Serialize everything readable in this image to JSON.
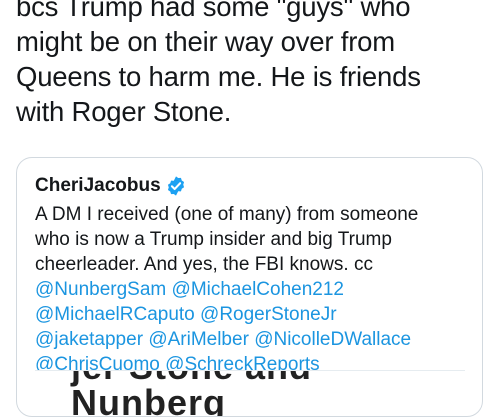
{
  "tweet": {
    "text": "bcs Trump had some \"guys\" who\nmight be on their way over from\nQueens to harm me.  He is friends\nwith Roger Stone."
  },
  "quote": {
    "author": "CheriJacobus",
    "verified_icon": "verified-badge-icon",
    "text_line1": "A DM I received (one of many) from someone",
    "text_line2": "who is now a Trump insider and big Trump",
    "text_line3": "cheerleader.  And yes, the FBI knows.  cc",
    "mentions_line4": [
      "@NunbergSam",
      "@MichaelCohen212"
    ],
    "mentions_line5": [
      "@MichaelRCaputo",
      "@RogerStoneJr"
    ],
    "mentions_line6": [
      "@jaketapper",
      "@AriMelber",
      "@NicolleDWallace"
    ],
    "mentions_line7": [
      "@ChrisCuomo",
      "@SchreckReports"
    ],
    "media_caption": "jer Stone and Nunberg"
  },
  "colors": {
    "text": "#14171a",
    "link": "#1b95e0",
    "verified": "#1da1f2",
    "border": "#d2d9df"
  }
}
